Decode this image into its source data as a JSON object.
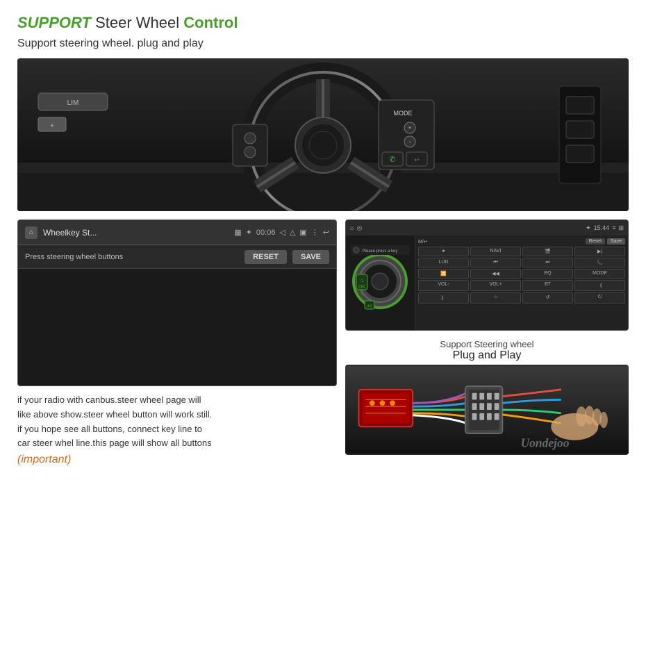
{
  "header": {
    "title_support": "SUPPORT",
    "title_rest": " Steer Wheel ",
    "title_control": "Control",
    "subtitle": "Support steering wheel. plug and play"
  },
  "left_panel": {
    "screenshot": {
      "title": "Wheelkey St...",
      "time": "00:06",
      "toolbar_label": "Press steering wheel buttons",
      "reset_btn": "RESET",
      "save_btn": "SAVE"
    },
    "description_lines": [
      "if your radio with canbus.steer wheel page will",
      "like above show.steer wheel button will work still.",
      "if you hope see all buttons, connect key line to",
      "car steer whel line.this page will show all buttons"
    ],
    "important_text": "(important)"
  },
  "right_panel": {
    "support_line1": "Support Steering wheel",
    "plug_play": "Plug and Play",
    "grid_cells": [
      "M/⏎",
      "●",
      "NAVI",
      "🎬",
      "▶|",
      "LUD",
      "⏮",
      "⏭",
      "📞",
      "🔀",
      "◀◀",
      "▶",
      "EQ",
      "MODE",
      "VOL-",
      "VOL+",
      "🔵",
      "《《",
      "》》",
      "🏠",
      "↺",
      "⏻"
    ],
    "rs_header_time": "15:44"
  },
  "watermark": "Uondejoo",
  "colors": {
    "green": "#4a9e2f",
    "orange": "#d2691e",
    "dark_bg": "#1a1a1a"
  }
}
